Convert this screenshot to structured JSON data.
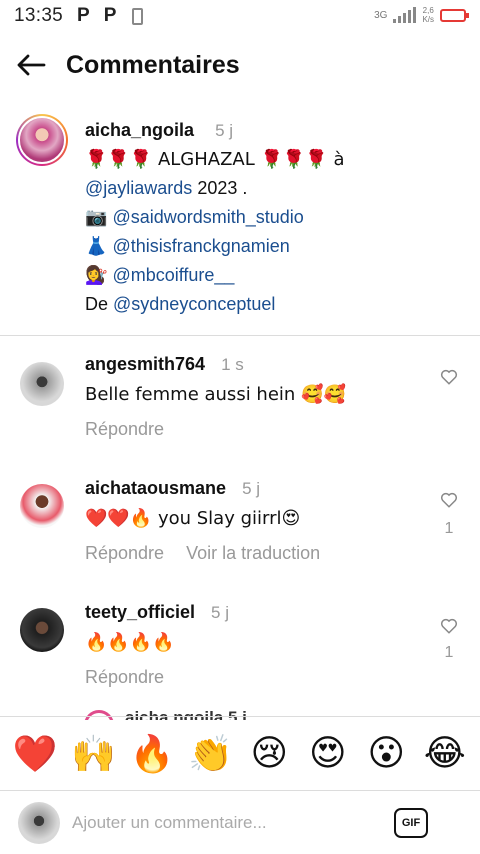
{
  "status_bar": {
    "time": "13:35",
    "app_icon_1": "P",
    "app_icon_2": "P",
    "network": "3G",
    "speed_value": "2,6",
    "speed_unit": "K/s"
  },
  "header": {
    "title": "Commentaires",
    "back_icon": "arrow-left-icon"
  },
  "caption": {
    "username": "aicha_ngoila",
    "time": "5 j",
    "line1_prefix": "🌹🌹🌹 ALGHAZAL 🌹🌹🌹 à",
    "line2_mention": "@jayliawards",
    "line2_suffix": " 2023 .",
    "line3_emoji": "📷",
    "line3_mention": "@saidwordsmith_studio",
    "line4_emoji": "👗",
    "line4_mention": "@thisisfranckgnamien",
    "line5_emoji": "💇‍♀️",
    "line5_mention": "@mbcoiffure__",
    "line6_prefix": "De ",
    "line6_mention": "@sydneyconceptuel"
  },
  "comments": [
    {
      "username": "angesmith764",
      "time": "1 s",
      "text": "Belle femme aussi hein 🥰🥰",
      "reply": "Répondre",
      "translate": "",
      "likes": ""
    },
    {
      "username": "aichataousmane",
      "time": "5 j",
      "text": "❤️❤️🔥 you Slay giirrl😍",
      "reply": "Répondre",
      "translate": "Voir la traduction",
      "likes": "1"
    },
    {
      "username": "teety_officiel",
      "time": "5 j",
      "text": "🔥🔥🔥🔥",
      "reply": "Répondre",
      "translate": "",
      "likes": "1"
    }
  ],
  "partial_comment": {
    "text": "aicha ngoila  5 j"
  },
  "emoji_bar": [
    "❤️",
    "🙌",
    "🔥",
    "👏",
    "😢",
    "😍",
    "😮",
    "😂"
  ],
  "compose": {
    "placeholder": "Ajouter un commentaire...",
    "gif_label": "GIF"
  },
  "colors": {
    "mention": "#1b4e8f",
    "muted": "#999999",
    "battery": "#e53935",
    "story_ring": "#d62c84"
  }
}
